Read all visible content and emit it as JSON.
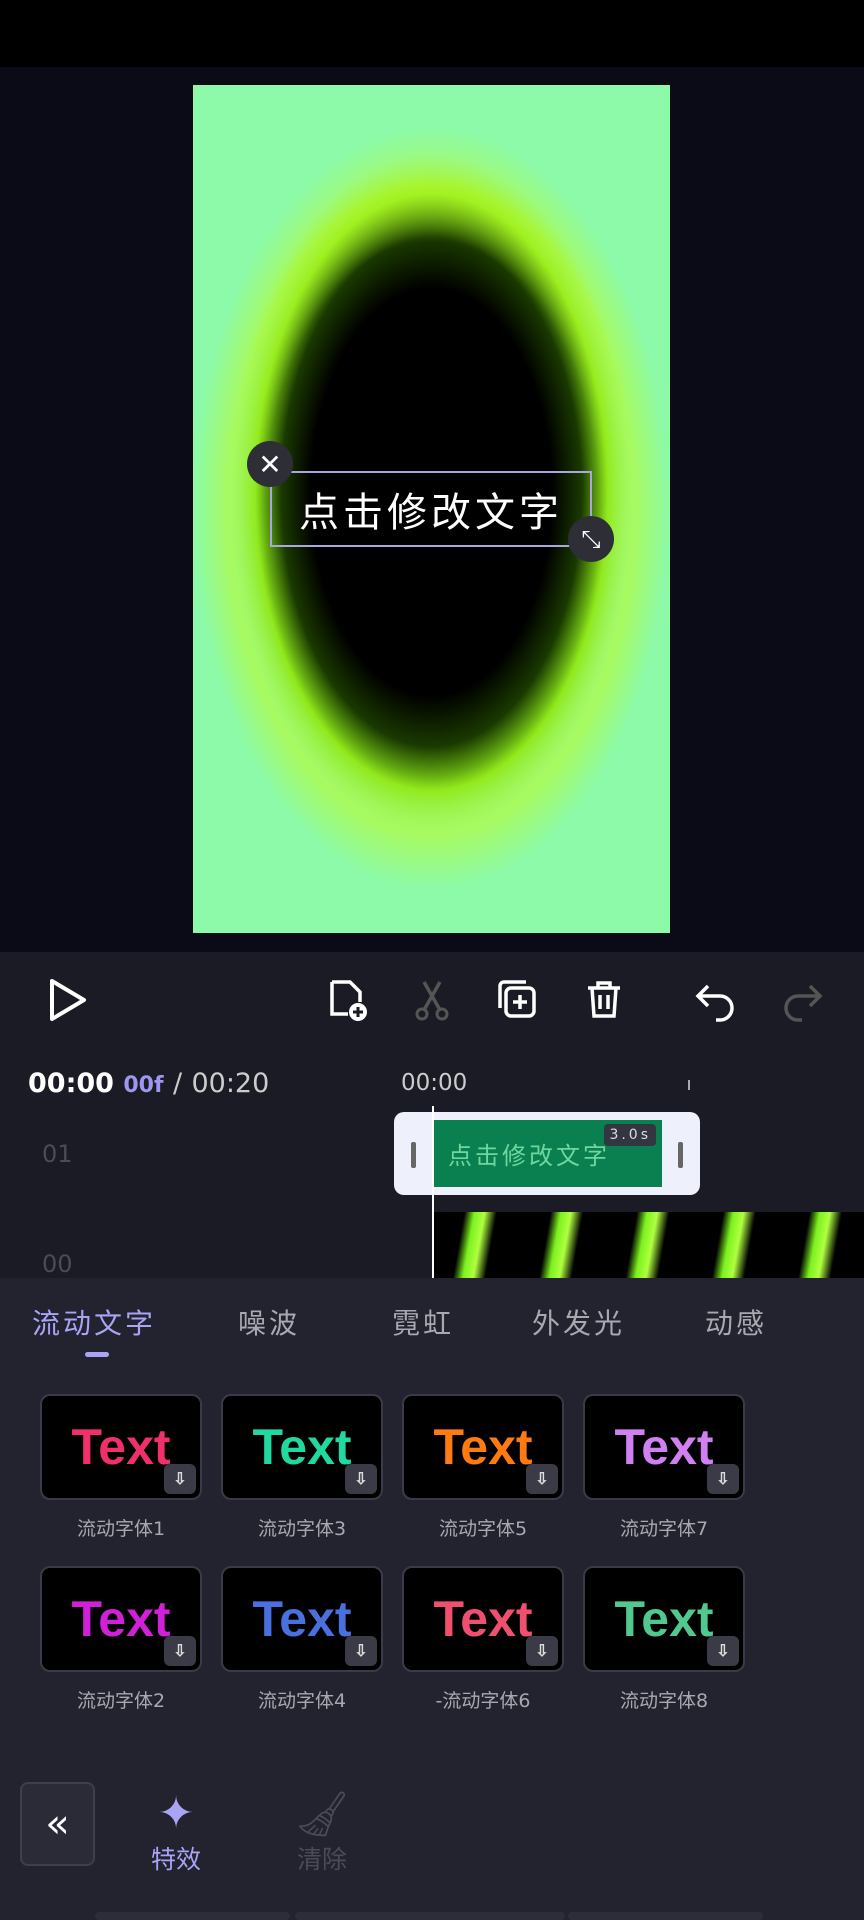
{
  "preview": {
    "overlay_text": "点击修改文字"
  },
  "toolbar": {
    "icons": [
      "play-icon",
      "add-clip-icon",
      "split-icon",
      "duplicate-icon",
      "delete-icon",
      "undo-icon",
      "redo-icon"
    ]
  },
  "timeline": {
    "current": "00:00",
    "frame": "00f",
    "separator": "/",
    "total": "00:20",
    "ruler_start": "00:00",
    "tracks": [
      "01",
      "00"
    ],
    "clip": {
      "text": "点击修改文字",
      "duration": "3.0s",
      "color": "#0a8050"
    }
  },
  "tabs": [
    "流动文字",
    "噪波",
    "霓虹",
    "外发光",
    "动感"
  ],
  "presets": [
    {
      "label": "流动字体1",
      "sample": "Text",
      "color": "#f0306a"
    },
    {
      "label": "流动字体3",
      "sample": "Text",
      "color": "#20d8a0"
    },
    {
      "label": "流动字体5",
      "sample": "Text",
      "color": "#ff7a10"
    },
    {
      "label": "流动字体7",
      "sample": "Text",
      "color": "#d080f0"
    },
    {
      "label": "流动字体2",
      "sample": "Text",
      "color": "#d020d8"
    },
    {
      "label": "流动字体4",
      "sample": "Text",
      "color": "#4a70e0"
    },
    {
      "label": "-流动字体6",
      "sample": "Text",
      "color": "#f05070"
    },
    {
      "label": "流动字体8",
      "sample": "Text",
      "color": "#50c890"
    }
  ],
  "bottom_nav": {
    "back": "«",
    "effects": "特效",
    "clear": "清除"
  },
  "colors": {
    "accent": "#a9a4f5",
    "panel": "#22232e"
  }
}
